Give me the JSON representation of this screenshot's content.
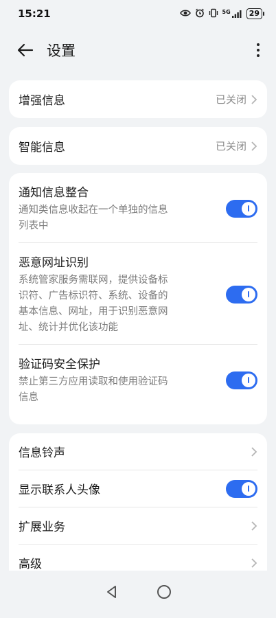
{
  "status_bar": {
    "time": "15:21",
    "network": "5G",
    "battery": "29"
  },
  "header": {
    "title": "设置"
  },
  "card1": {
    "label": "增强信息",
    "value": "已关闭"
  },
  "card2": {
    "label": "智能信息",
    "value": "已关闭"
  },
  "toggles": [
    {
      "label": "通知信息整合",
      "desc_line1": "通知类信息收起在一个单独的信息",
      "desc_line2": "列表中",
      "on": true
    },
    {
      "label": "恶意网址识别",
      "desc_line1": "系统管家服务需联网，提供设备标",
      "desc_line2": "识符、广告标识符、系统、设备的",
      "desc_line3": "基本信息、网址，用于识别恶意网",
      "desc_line4": "址、统计并优化该功能",
      "on": true
    },
    {
      "label": "验证码安全保护",
      "desc_line1": "禁止第三方应用读取和使用验证码",
      "desc_line2": "信息",
      "on": true
    }
  ],
  "card4": {
    "ringtone": "信息铃声",
    "show_avatar": "显示联系人头像",
    "show_avatar_on": true,
    "extended": "扩展业务",
    "advanced": "高级"
  },
  "icons": {
    "back": "arrow-left-icon",
    "more": "more-vertical-icon",
    "chevron": "chevron-right-icon",
    "eye": "eye-icon",
    "alarm": "alarm-icon",
    "vibrate": "vibrate-icon",
    "signal": "signal-icon",
    "battery": "battery-icon"
  },
  "colors": {
    "accent": "#2d6cf0",
    "background": "#f1f3f5",
    "card": "#ffffff"
  }
}
